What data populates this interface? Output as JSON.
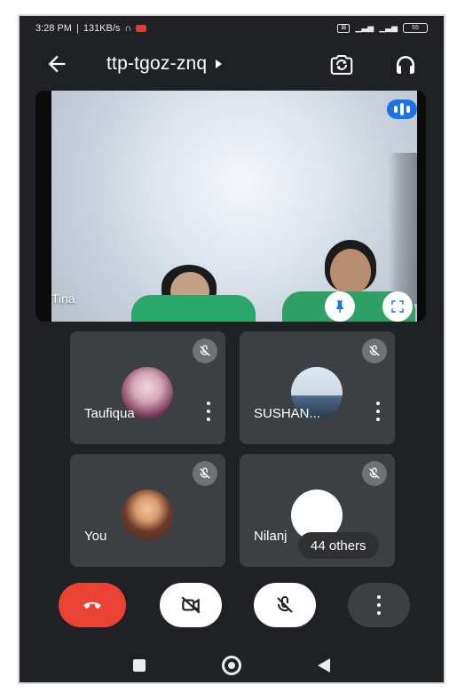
{
  "statusbar": {
    "time": "3:28 PM",
    "speed": "131KB/s",
    "battery": "55"
  },
  "header": {
    "meeting_code": "ttp-tgoz-znq"
  },
  "main_video": {
    "participant_name": "Tina"
  },
  "tiles": [
    {
      "name": "Taufiqua"
    },
    {
      "name": "SUSHAN..."
    },
    {
      "name": "You"
    },
    {
      "name": "Nilanj",
      "others_label": "44 others"
    }
  ],
  "colors": {
    "end_call": "#ea4335",
    "audio_indicator": "#1a73e8",
    "background": "#202124",
    "tile": "#3c4043"
  },
  "icons": {
    "back": "arrow-left",
    "switch_camera": "camera-rotate",
    "audio_output": "headphones",
    "audio_indicator": "audio-level",
    "pin": "pin",
    "fullscreen": "fullscreen",
    "muted": "mic-off",
    "more": "vertical-dots",
    "end_call": "phone-hangup",
    "camera_off": "video-off",
    "mic_off": "mic-off"
  }
}
